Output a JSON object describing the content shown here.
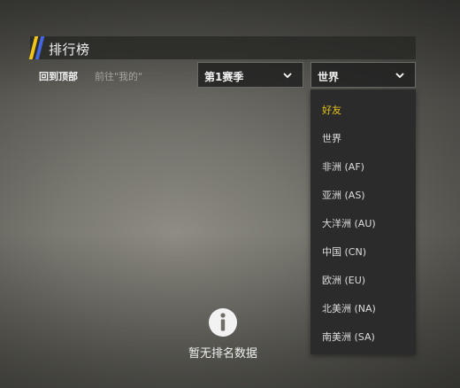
{
  "header": {
    "title": "排行榜"
  },
  "nav": {
    "back_to_top": "回到顶部",
    "go_to_mine": "前往\"我的\""
  },
  "season_select": {
    "value": "第1赛季"
  },
  "region_select": {
    "value": "世界",
    "options": [
      {
        "label": "好友",
        "active": true
      },
      {
        "label": "世界"
      },
      {
        "label": "非洲 (AF)"
      },
      {
        "label": "亚洲 (AS)"
      },
      {
        "label": "大洋洲 (AU)"
      },
      {
        "label": "中国 (CN)"
      },
      {
        "label": "欧洲 (EU)"
      },
      {
        "label": "北美洲 (NA)"
      },
      {
        "label": "南美洲 (SA)"
      }
    ]
  },
  "empty_state": {
    "icon": "info-icon",
    "text": "暂无排名数据"
  },
  "colors": {
    "accent_yellow": "#f0c419",
    "accent_blue": "#4466e0",
    "active_option": "#e6c21a"
  }
}
